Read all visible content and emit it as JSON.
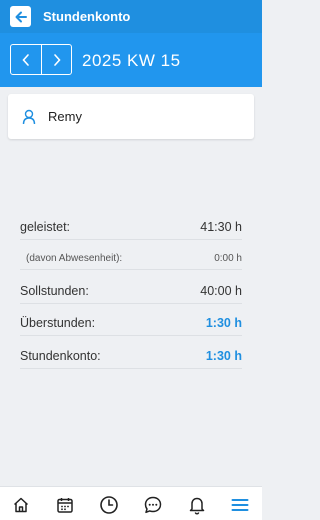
{
  "header": {
    "title": "Stundenkonto"
  },
  "week": {
    "label": "2025 KW 15"
  },
  "user": {
    "name": "Remy"
  },
  "summary": {
    "rows": [
      {
        "label": "geleistet:",
        "value": "41:30 h"
      },
      {
        "label": "(davon Abwesenheit):",
        "value": "0:00 h"
      },
      {
        "label": "Sollstunden:",
        "value": "40:00 h"
      },
      {
        "label": "Überstunden:",
        "value": "1:30 h"
      },
      {
        "label": "Stundenkonto:",
        "value": "1:30 h"
      }
    ]
  },
  "bottom_nav": {
    "items": [
      {
        "icon": "home-icon"
      },
      {
        "icon": "calendar-icon"
      },
      {
        "icon": "clock-icon"
      },
      {
        "icon": "chat-icon"
      },
      {
        "icon": "bell-icon"
      },
      {
        "icon": "menu-icon"
      }
    ]
  },
  "colors": {
    "primary": "#1f8fe0",
    "header_secondary": "#2196ee",
    "background": "#eef0f3"
  }
}
